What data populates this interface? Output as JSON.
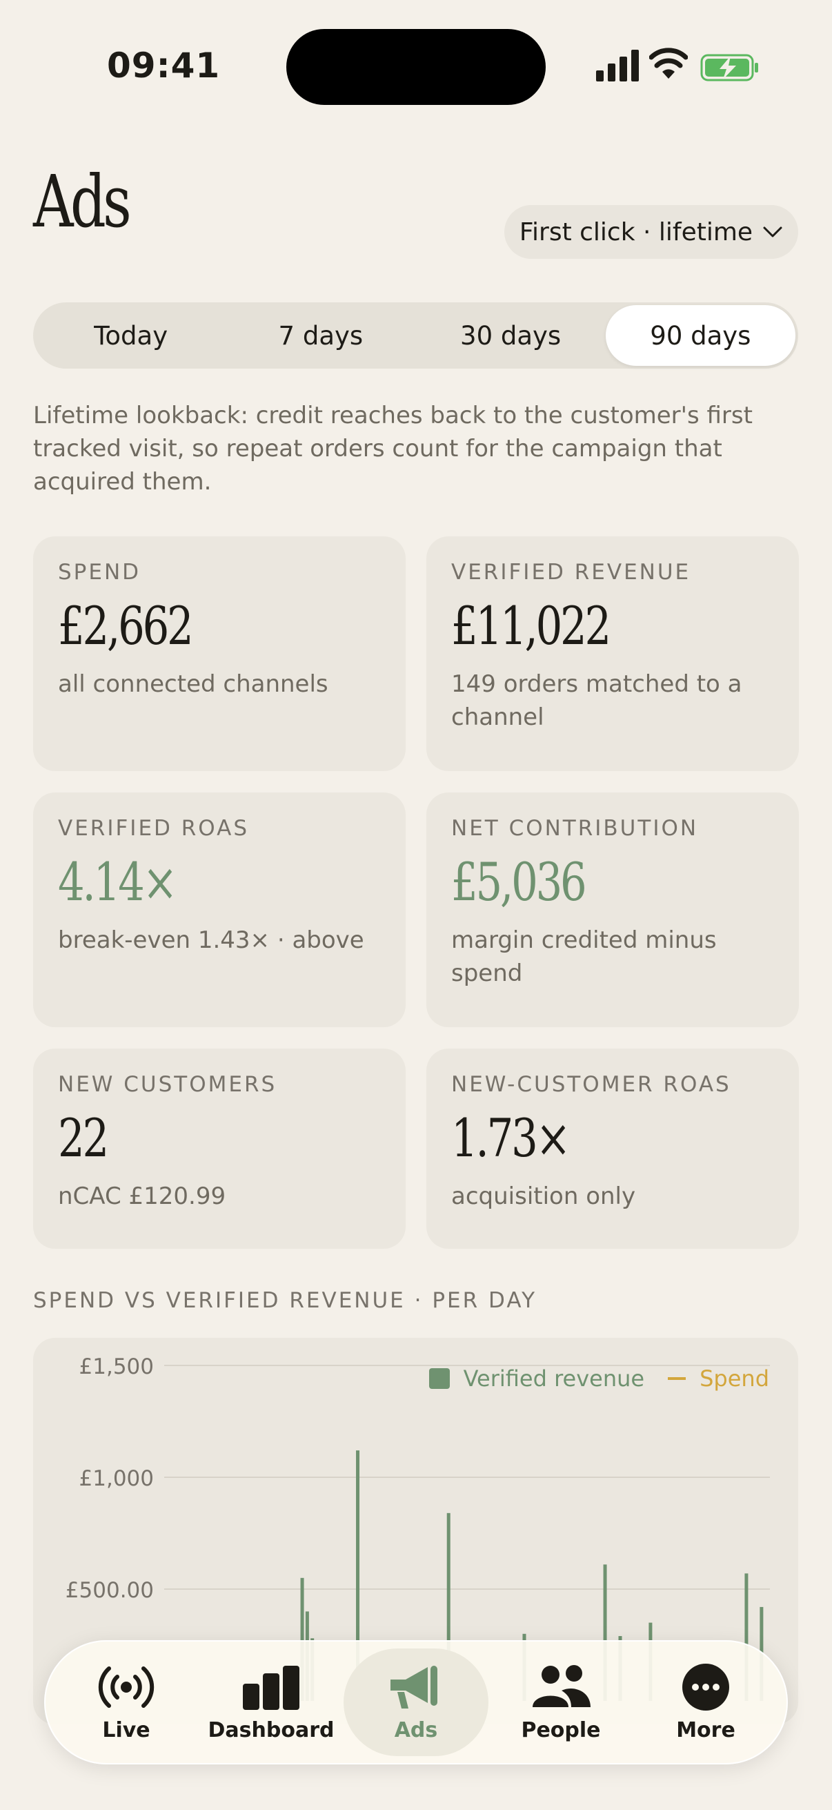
{
  "status": {
    "time": "09:41"
  },
  "header": {
    "title": "Ads",
    "attribution_label": "First click · lifetime"
  },
  "range_tabs": [
    "Today",
    "7 days",
    "30 days",
    "90 days"
  ],
  "active_range": "90 days",
  "explanation": "Lifetime lookback: credit reaches back to the customer's first tracked visit, so repeat orders count for the campaign that acquired them.",
  "metrics": [
    {
      "label": "SPEND",
      "value": "£2,662",
      "sub": "all connected channels"
    },
    {
      "label": "VERIFIED REVENUE",
      "value": "£11,022",
      "sub": "149 orders matched to a channel"
    },
    {
      "label": "VERIFIED ROAS",
      "value": "4.14×",
      "sub": "break-even 1.43× · above"
    },
    {
      "label": "NET CONTRIBUTION",
      "value": "£5,036",
      "sub": "margin credited minus spend"
    },
    {
      "label": "NEW CUSTOMERS",
      "value": "22",
      "sub": "nCAC £120.99"
    },
    {
      "label": "NEW-CUSTOMER ROAS",
      "value": "1.73×",
      "sub": "acquisition only"
    }
  ],
  "chart_section_title": "SPEND VS VERIFIED REVENUE · PER DAY",
  "chart_data": {
    "type": "bar",
    "title": "SPEND VS VERIFIED REVENUE · PER DAY",
    "y_ticks": [
      "£1,500",
      "£1,000",
      "£500.00"
    ],
    "ylim": [
      0,
      1500
    ],
    "grid": true,
    "legend_position": "top-right",
    "series": [
      {
        "name": "Verified revenue",
        "color": "#6f9270",
        "values": [
          0,
          0,
          0,
          0,
          0,
          0,
          0,
          0,
          0,
          0,
          0,
          0,
          0,
          0,
          0,
          0,
          0,
          0,
          0,
          0,
          0,
          0,
          0,
          0,
          0,
          0,
          0,
          550,
          400,
          280,
          0,
          0,
          0,
          0,
          0,
          0,
          0,
          0,
          1120,
          0,
          0,
          0,
          0,
          0,
          0,
          0,
          0,
          0,
          0,
          0,
          0,
          0,
          0,
          0,
          0,
          0,
          0,
          0,
          0,
          0,
          0,
          0,
          0,
          0,
          0,
          0,
          0,
          0,
          0,
          0,
          0,
          0,
          0,
          0,
          0,
          0,
          0,
          0,
          0,
          0,
          0,
          0,
          0,
          0,
          0,
          0,
          0,
          0,
          0,
          0
        ]
      },
      {
        "name": "Spend",
        "color": "#d3a63c",
        "values": []
      }
    ],
    "visible_bars": [
      {
        "day": 27,
        "value": 550
      },
      {
        "day": 28,
        "value": 400
      },
      {
        "day": 29,
        "value": 280
      },
      {
        "day": 38,
        "value": 1120
      },
      {
        "day": 56,
        "value": 840
      },
      {
        "day": 71,
        "value": 300
      },
      {
        "day": 87,
        "value": 610
      },
      {
        "day": 90,
        "value": 290
      },
      {
        "day": 96,
        "value": 350
      },
      {
        "day": 115,
        "value": 570
      },
      {
        "day": 118,
        "value": 420
      }
    ],
    "x_days": 120
  },
  "tab_bar": [
    {
      "label": "Live",
      "icon": "broadcast-icon"
    },
    {
      "label": "Dashboard",
      "icon": "bar-chart-icon"
    },
    {
      "label": "Ads",
      "icon": "megaphone-icon"
    },
    {
      "label": "People",
      "icon": "people-icon"
    },
    {
      "label": "More",
      "icon": "more-icon"
    }
  ],
  "active_tab": "Ads",
  "colors": {
    "accent": "#6f9270",
    "spend": "#d3a63c",
    "background": "#f4f0e9"
  }
}
